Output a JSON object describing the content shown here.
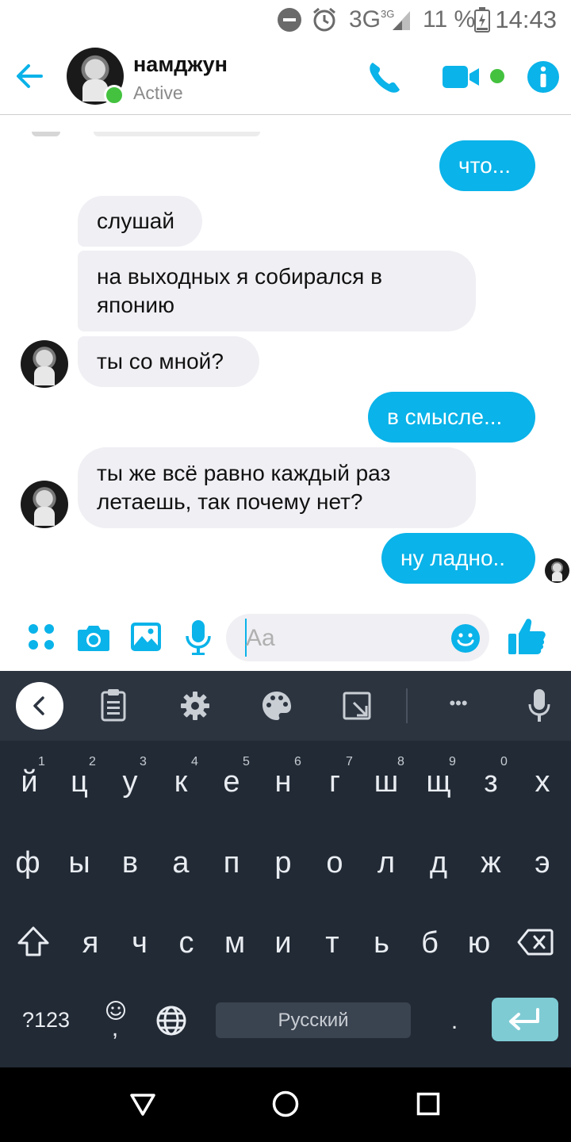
{
  "status_bar": {
    "network": "3G",
    "network_sup": "3G",
    "battery": "11 %",
    "time": "14:43"
  },
  "header": {
    "contact_name": "намджун",
    "contact_status": "Active",
    "icons": [
      "back-arrow-icon",
      "phone-icon",
      "video-camera-icon",
      "info-icon"
    ]
  },
  "messages": [
    {
      "side": "outgoing",
      "text": "что..."
    },
    {
      "side": "incoming",
      "text": "слушай"
    },
    {
      "side": "incoming",
      "line1": "на выходных я собирался в",
      "line2": "японию"
    },
    {
      "side": "incoming",
      "text": "ты со мной?"
    },
    {
      "side": "outgoing",
      "text": "в смысле..."
    },
    {
      "side": "incoming",
      "line1": "ты же всё равно каждый раз",
      "line2": "летаешь, так почему нет?"
    },
    {
      "side": "outgoing",
      "text": "ну ладно.."
    }
  ],
  "composer": {
    "placeholder": "Aa",
    "icons": [
      "apps-grid-icon",
      "camera-icon",
      "image-icon",
      "microphone-icon",
      "emoji-icon",
      "thumbs-up-icon"
    ]
  },
  "keyboard": {
    "toolbar_icons": [
      "collapse-chevron-icon",
      "clipboard-icon",
      "settings-gear-icon",
      "palette-icon",
      "resize-icon",
      "more-dots-icon",
      "voice-mic-icon"
    ],
    "more_label": "•••",
    "row1": [
      "й",
      "ц",
      "у",
      "к",
      "е",
      "н",
      "г",
      "ш",
      "щ",
      "з",
      "х"
    ],
    "row1_hints": [
      "1",
      "2",
      "3",
      "4",
      "5",
      "6",
      "7",
      "8",
      "9",
      "0"
    ],
    "row2": [
      "ф",
      "ы",
      "в",
      "а",
      "п",
      "р",
      "о",
      "л",
      "д",
      "ж",
      "э"
    ],
    "row3": [
      "я",
      "ч",
      "с",
      "м",
      "и",
      "т",
      "ь",
      "б",
      "ю"
    ],
    "symbols_label": "?123",
    "comma_label": ",",
    "space_label": "Русский",
    "period_label": "."
  },
  "colors": {
    "accent": "#0ab3e9",
    "online": "#44c23f",
    "keyboard_bg": "#222a35",
    "keyboard_toolbar_bg": "#2c3440",
    "enter_key": "#7ecbd4"
  }
}
